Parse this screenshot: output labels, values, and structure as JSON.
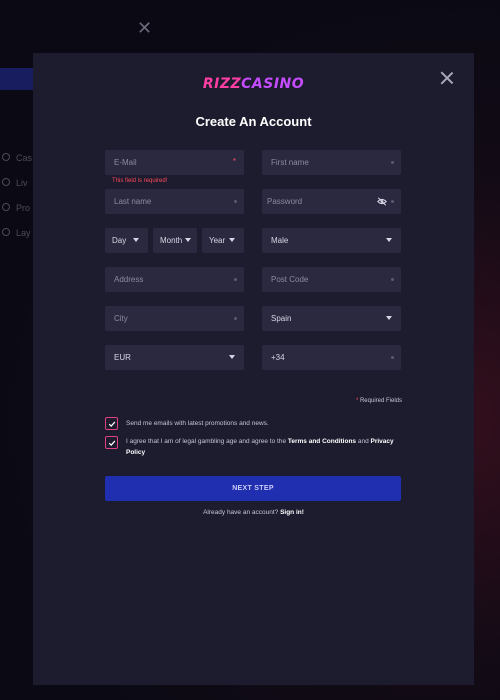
{
  "background": {
    "close_glyph": "✕",
    "menu_items": [
      "Cas",
      "Liv",
      "Pro",
      "Lay"
    ]
  },
  "logo": {
    "part1": "RIZZ",
    "part2": "CASINO"
  },
  "title": "Create An Account",
  "form": {
    "email": {
      "placeholder": "E-Mail",
      "required_mark": "*",
      "error": "This field is required!"
    },
    "first_name": {
      "placeholder": "First name"
    },
    "last_name": {
      "placeholder": "Last name"
    },
    "password": {
      "placeholder": "Password"
    },
    "day": {
      "value": "Day"
    },
    "month": {
      "value": "Month"
    },
    "year": {
      "value": "Year"
    },
    "gender": {
      "value": "Male"
    },
    "address": {
      "placeholder": "Address"
    },
    "post_code": {
      "placeholder": "Post Code"
    },
    "city": {
      "placeholder": "City"
    },
    "country": {
      "value": "Spain"
    },
    "currency": {
      "value": "EUR"
    },
    "phone_prefix": {
      "value": "+34"
    }
  },
  "required_note": {
    "star": "*",
    "text": "Required Fields"
  },
  "consents": {
    "emails": "Send me emails with latest promotions and news.",
    "terms_prefix": "I agree that I am of legal gambling age and agree to the ",
    "terms_link": "Terms and Conditions",
    "terms_and": " and ",
    "privacy_link": "Privacy Policy"
  },
  "next_button": "NEXT STEP",
  "signin": {
    "prefix": "Already have an account? ",
    "link": "Sign in!"
  },
  "colors": {
    "modal_bg": "#1d1b2e",
    "field_bg": "#2b2940",
    "accent": "#1f2fb0",
    "error": "#ff4a5a",
    "checkbox": "#e0417f"
  }
}
